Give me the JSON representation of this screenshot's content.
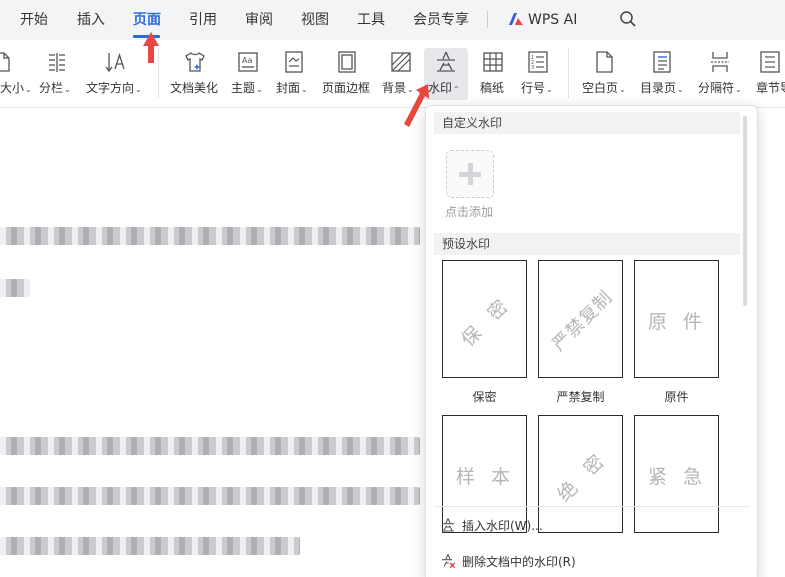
{
  "menu": {
    "tabs": [
      "开始",
      "插入",
      "页面",
      "引用",
      "审阅",
      "视图",
      "工具",
      "会员专享"
    ],
    "active_tab": "页面",
    "wps_ai": "WPS AI"
  },
  "ribbon": {
    "size": "大小",
    "columns": "分栏",
    "text_direction": "文字方向",
    "beautify": "文档美化",
    "theme": "主题",
    "cover": "封面",
    "page_border": "页面边框",
    "background": "背景",
    "watermark": "水印",
    "manuscript": "稿纸",
    "line_number": "行号",
    "blank_page": "空白页",
    "toc_page": "目录页",
    "separator": "分隔符",
    "section": "章节导"
  },
  "watermark_panel": {
    "custom_header": "自定义水印",
    "add_label": "点击添加",
    "preset_header": "预设水印",
    "presets": [
      {
        "text": "保 密",
        "label": "保密"
      },
      {
        "text": "严禁复制",
        "label": "严禁复制"
      },
      {
        "text": "原 件",
        "label": "原件"
      },
      {
        "text": "样 本",
        "label": ""
      },
      {
        "text": "绝 密",
        "label": ""
      },
      {
        "text": "紧 急",
        "label": ""
      }
    ],
    "insert_item": "插入水印(W)...",
    "delete_item": "删除文档中的水印(R)"
  },
  "colors": {
    "accent": "#2c6bdb",
    "annotation": "#e8473f",
    "delete_icon": "#d93a32"
  }
}
